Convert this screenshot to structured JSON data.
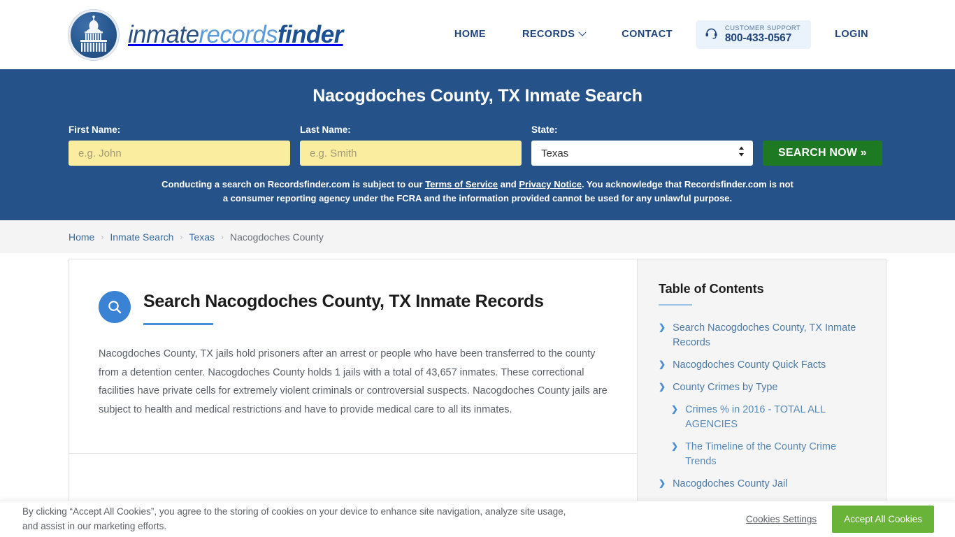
{
  "header": {
    "logo": {
      "icon": "capitol-dome-icon",
      "part1": "inmate",
      "part2": "records",
      "part3": "finder"
    },
    "nav": [
      {
        "label": "HOME",
        "name": "nav-home",
        "dropdown": false
      },
      {
        "label": "RECORDS",
        "name": "nav-records",
        "dropdown": true
      },
      {
        "label": "CONTACT",
        "name": "nav-contact",
        "dropdown": false
      }
    ],
    "support": {
      "icon": "headset-icon",
      "label": "CUSTOMER SUPPORT",
      "phone": "800-433-0567"
    },
    "login_label": "LOGIN"
  },
  "hero": {
    "title": "Nacogdoches County, TX Inmate Search",
    "first_name": {
      "label": "First Name:",
      "placeholder": "e.g. John",
      "value": ""
    },
    "last_name": {
      "label": "Last Name:",
      "placeholder": "e.g. Smith",
      "value": ""
    },
    "state": {
      "label": "State:",
      "value": "Texas"
    },
    "search_button": "SEARCH NOW »",
    "disclaimer": {
      "part1": "Conducting a search on Recordsfinder.com is subject to our ",
      "link1": "Terms of Service",
      "mid": " and ",
      "link2": "Privacy Notice",
      "part2": ". You acknowledge that Recordsfinder.com is not a consumer reporting agency under the FCRA and the information provided cannot be used for any unlawful purpose."
    }
  },
  "breadcrumb": [
    {
      "label": "Home",
      "current": false
    },
    {
      "label": "Inmate Search",
      "current": false
    },
    {
      "label": "Texas",
      "current": false
    },
    {
      "label": "Nacogdoches County",
      "current": true
    }
  ],
  "breadcrumb_separator": "›",
  "article": {
    "icon": "magnifier-icon",
    "heading": "Search Nacogdoches County, TX Inmate Records",
    "body": "Nacogdoches County, TX jails hold prisoners after an arrest or people who have been transferred to the county from a detention center. Nacogdoches County holds 1 jails with a total of 43,657 inmates. These correctional facilities have private cells for extremely violent criminals or controversial suspects. Nacogdoches County jails are subject to health and medical restrictions and have to provide medical care to all its inmates."
  },
  "toc": {
    "title": "Table of Contents",
    "items": [
      {
        "label": "Search Nacogdoches County, TX Inmate Records",
        "sub": false
      },
      {
        "label": "Nacogdoches County Quick Facts",
        "sub": false
      },
      {
        "label": "County Crimes by Type",
        "sub": false
      },
      {
        "label": "Crimes % in 2016 - TOTAL ALL AGENCIES",
        "sub": true
      },
      {
        "label": "The Timeline of the County Crime Trends",
        "sub": true
      },
      {
        "label": "Nacogdoches County Jail",
        "sub": false
      }
    ],
    "arrow_glyph": "❯"
  },
  "cookie_banner": {
    "text": "By clicking “Accept All Cookies”, you agree to the storing of cookies on your device to enhance site navigation, analyze site usage, and assist in our marketing efforts.",
    "settings_label": "Cookies Settings",
    "accept_label": "Accept All Cookies"
  },
  "colors": {
    "hero_blue": "#255289",
    "brand_blue": "#20457a",
    "accent_blue": "#4a8fd4",
    "search_green": "#1e7a22",
    "accept_green": "#68b338",
    "input_yellow": "#fbeda0"
  }
}
